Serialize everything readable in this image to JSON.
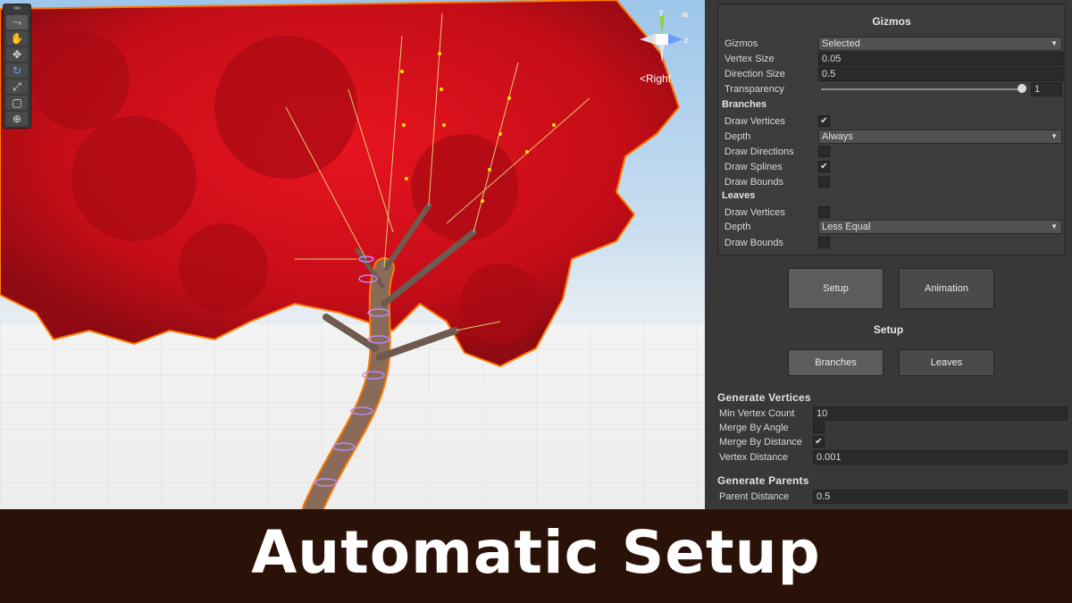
{
  "scene": {
    "toolbar": {
      "tools": [
        "custom-tool",
        "hand-tool",
        "move-tool",
        "rotate-tool",
        "scale-tool",
        "rect-tool",
        "transform-tool"
      ]
    },
    "orientation": {
      "y_axis": "y",
      "z_axis": "z",
      "view_label": "Right"
    }
  },
  "gizmos": {
    "title": "Gizmos",
    "gizmos_label": "Gizmos",
    "gizmos_value": "Selected",
    "vertex_size_label": "Vertex Size",
    "vertex_size_value": "0.05",
    "direction_size_label": "Direction Size",
    "direction_size_value": "0.5",
    "transparency_label": "Transparency",
    "transparency_value": "1",
    "branches_header": "Branches",
    "b_draw_vertices_label": "Draw Vertices",
    "b_draw_vertices": true,
    "b_depth_label": "Depth",
    "b_depth_value": "Always",
    "b_draw_directions_label": "Draw Directions",
    "b_draw_directions": false,
    "b_draw_splines_label": "Draw Splines",
    "b_draw_splines": true,
    "b_draw_bounds_label": "Draw Bounds",
    "b_draw_bounds": false,
    "leaves_header": "Leaves",
    "l_draw_vertices_label": "Draw Vertices",
    "l_draw_vertices": false,
    "l_depth_label": "Depth",
    "l_depth_value": "Less Equal",
    "l_draw_bounds_label": "Draw Bounds",
    "l_draw_bounds": false
  },
  "mode_tabs": {
    "setup": "Setup",
    "animation": "Animation"
  },
  "setup": {
    "header": "Setup",
    "tabs": {
      "branches": "Branches",
      "leaves": "Leaves"
    },
    "generate_vertices_title": "Generate  Vertices",
    "min_vertex_count_label": "Min Vertex Count",
    "min_vertex_count": "10",
    "merge_by_angle_label": "Merge By Angle",
    "merge_by_angle": false,
    "merge_by_distance_label": "Merge By Distance",
    "merge_by_distance": true,
    "vertex_distance_label": "Vertex Distance",
    "vertex_distance": "0.001",
    "generate_parents_title": "Generate  Parents",
    "parent_distance_label": "Parent Distance",
    "parent_distance": "0.5"
  },
  "banner": {
    "title": "Automatic Setup"
  },
  "colors": {
    "panel_bg": "#383838",
    "banner_bg": "#2b1208",
    "foliage": "#d4101c",
    "selection": "#ff7a00"
  }
}
